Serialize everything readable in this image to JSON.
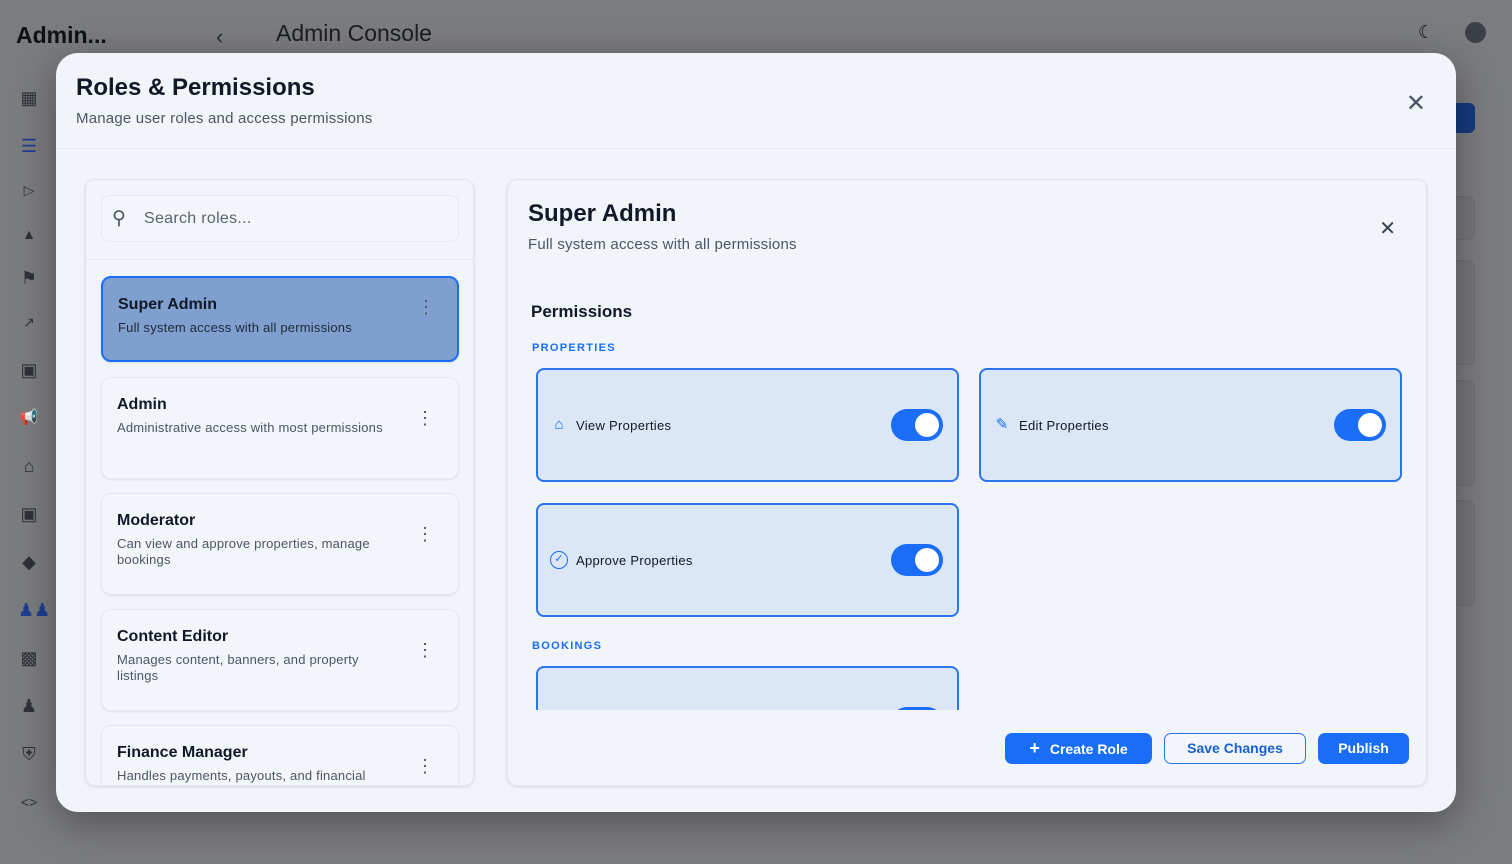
{
  "app": {
    "title": "Admin...",
    "page_title": "Admin Console"
  },
  "icons": {
    "back": "chevron-left-icon",
    "theme": "moon-icon",
    "account": "user-circle-icon"
  },
  "modal": {
    "title": "Roles & Permissions",
    "subtitle": "Manage user roles and access permissions",
    "search_placeholder": "Search roles...",
    "roles": [
      {
        "name": "Super Admin",
        "description": "Full system access with all permissions",
        "selected": true
      },
      {
        "name": "Admin",
        "description": "Administrative access with most permissions"
      },
      {
        "name": "Moderator",
        "description": "Can view and approve properties, manage bookings"
      },
      {
        "name": "Content Editor",
        "description": "Manages content, banners, and property listings"
      },
      {
        "name": "Finance Manager",
        "description": "Handles payments, payouts, and financial"
      }
    ],
    "detail": {
      "title": "Super Admin",
      "subtitle": "Full system access with all permissions",
      "permissions_heading": "Permissions",
      "sections": [
        {
          "label": "PROPERTIES",
          "items": [
            {
              "label": "View Properties",
              "icon": "home-icon",
              "enabled": true
            },
            {
              "label": "Edit Properties",
              "icon": "pencil-icon",
              "enabled": true
            },
            {
              "label": "Approve Properties",
              "icon": "check-circle-icon",
              "enabled": true
            }
          ]
        },
        {
          "label": "BOOKINGS",
          "items": [
            {
              "label": "",
              "enabled": true
            }
          ]
        }
      ]
    },
    "buttons": {
      "create": "Create Role",
      "save": "Save Changes",
      "publish": "Publish"
    }
  },
  "colors": {
    "accent": "#1a6ef5",
    "selected_bg": "#7f9fcf",
    "card_bg": "#dbe6f7"
  }
}
